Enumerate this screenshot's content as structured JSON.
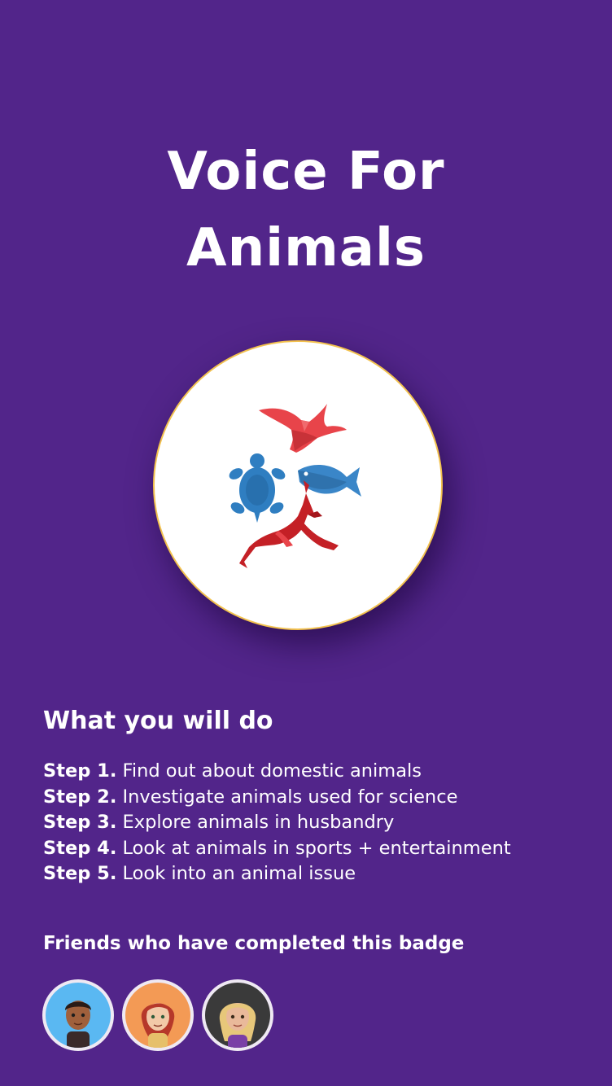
{
  "badge": {
    "title_line1": "Voice For",
    "title_line2": "Animals",
    "icon": "animals-badge-icon",
    "colors": {
      "background": "#52258a",
      "border": "#f2c14e",
      "bird": "#e8444a",
      "turtle": "#2f7ec1",
      "fish": "#3a86c8",
      "gazelle": "#c42026"
    }
  },
  "section": {
    "heading": "What you will do"
  },
  "steps": [
    {
      "label": "Step 1.",
      "text": " Find out about domestic animals"
    },
    {
      "label": "Step 2.",
      "text": "Investigate animals used for science"
    },
    {
      "label": "Step 3.",
      "text": "Explore animals in husbandry"
    },
    {
      "label": "Step 4.",
      "text": "Look at animals in sports + entertainment"
    },
    {
      "label": "Step 5.",
      "text": "Look into an animal issue"
    }
  ],
  "friends": {
    "heading": "Friends who have completed this badge",
    "avatars": [
      {
        "name": "friend-avatar-1",
        "bg": "#5ab8f2"
      },
      {
        "name": "friend-avatar-2",
        "bg": "#f39a55"
      },
      {
        "name": "friend-avatar-3",
        "bg": "#3a3a3a"
      }
    ]
  }
}
